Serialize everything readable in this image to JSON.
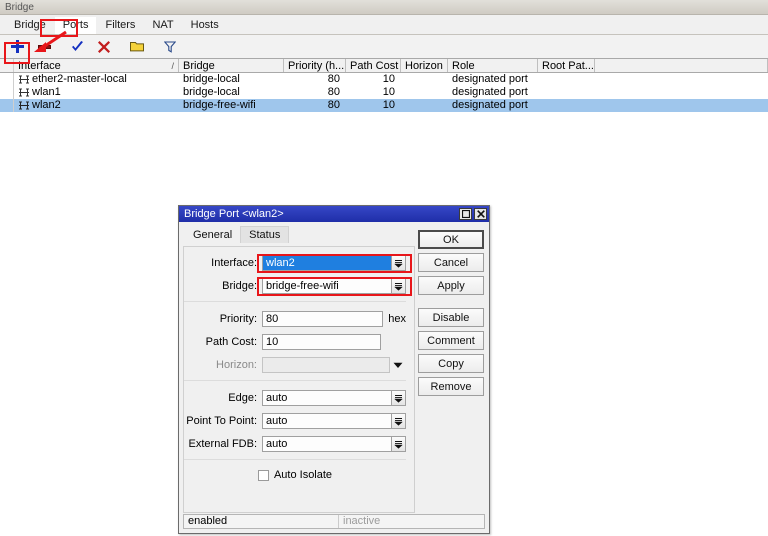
{
  "window": {
    "title": "Bridge",
    "tabs": [
      {
        "label": "Bridge",
        "active": false
      },
      {
        "label": "Ports",
        "active": true
      },
      {
        "label": "Filters",
        "active": false
      },
      {
        "label": "NAT",
        "active": false
      },
      {
        "label": "Hosts",
        "active": false
      }
    ],
    "toolbar": [
      {
        "name": "add-button",
        "icon": "plus-icon"
      },
      {
        "name": "remove-button",
        "icon": "minus-icon"
      },
      {
        "name": "enable-button",
        "icon": "check-icon"
      },
      {
        "name": "disable-button",
        "icon": "x-icon"
      },
      {
        "name": "comment-button",
        "icon": "folder-icon"
      },
      {
        "name": "filter-button",
        "icon": "filter-icon"
      }
    ]
  },
  "table": {
    "columns": [
      {
        "label": "Interface",
        "sort": "/"
      },
      {
        "label": "Bridge"
      },
      {
        "label": "Priority (h..."
      },
      {
        "label": "Path Cost"
      },
      {
        "label": "Horizon"
      },
      {
        "label": "Role"
      },
      {
        "label": "Root Pat..."
      }
    ],
    "rows": [
      {
        "interface": "ether2-master-local",
        "bridge": "bridge-local",
        "priority": "80",
        "path_cost": "10",
        "horizon": "",
        "role": "designated port",
        "root_path": "",
        "selected": false
      },
      {
        "interface": "wlan1",
        "bridge": "bridge-local",
        "priority": "80",
        "path_cost": "10",
        "horizon": "",
        "role": "designated port",
        "root_path": "",
        "selected": false
      },
      {
        "interface": "wlan2",
        "bridge": "bridge-free-wifi",
        "priority": "80",
        "path_cost": "10",
        "horizon": "",
        "role": "designated port",
        "root_path": "",
        "selected": true
      }
    ]
  },
  "dialog": {
    "title": "Bridge Port <wlan2>",
    "tabs": [
      {
        "label": "General",
        "active": true
      },
      {
        "label": "Status",
        "active": false
      }
    ],
    "fields": {
      "interface_label": "Interface:",
      "interface_value": "wlan2",
      "bridge_label": "Bridge:",
      "bridge_value": "bridge-free-wifi",
      "priority_label": "Priority:",
      "priority_value": "80",
      "priority_suffix": "hex",
      "path_cost_label": "Path Cost:",
      "path_cost_value": "10",
      "horizon_label": "Horizon:",
      "horizon_value": "",
      "edge_label": "Edge:",
      "edge_value": "auto",
      "p2p_label": "Point To Point:",
      "p2p_value": "auto",
      "external_fdb_label": "External FDB:",
      "external_fdb_value": "auto",
      "auto_isolate_label": "Auto Isolate"
    },
    "buttons": [
      {
        "label": "OK",
        "default": true,
        "gap": false
      },
      {
        "label": "Cancel",
        "default": false,
        "gap": false
      },
      {
        "label": "Apply",
        "default": false,
        "gap": false
      },
      {
        "label": "Disable",
        "default": false,
        "gap": true
      },
      {
        "label": "Comment",
        "default": false,
        "gap": false
      },
      {
        "label": "Copy",
        "default": false,
        "gap": false
      },
      {
        "label": "Remove",
        "default": false,
        "gap": false
      }
    ],
    "status": {
      "left": "enabled",
      "right": "inactive"
    }
  },
  "annotations": {
    "color": "#e8161a",
    "highlights": [
      "ports-tab",
      "add-button",
      "interface-field",
      "bridge-field"
    ]
  }
}
